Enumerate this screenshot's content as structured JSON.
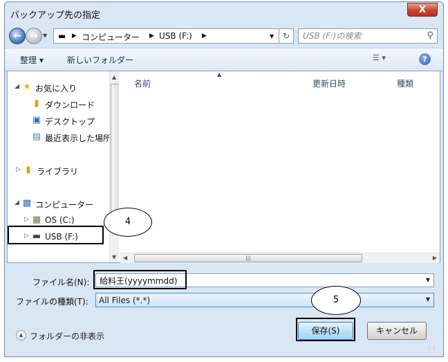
{
  "window": {
    "title": "バックアップ先の指定",
    "close_label": "X"
  },
  "address": {
    "crumbs": [
      "コンピューター",
      "USB (F:)"
    ],
    "search_placeholder": "USB (F:)の検索"
  },
  "toolbar": {
    "organize_label": "整理 ▾",
    "new_folder_label": "新しいフォルダー"
  },
  "nav": {
    "favorites": "お気に入り",
    "downloads": "ダウンロード",
    "desktop": "デスクトップ",
    "recent": "最近表示した場所",
    "libraries": "ライブラリ",
    "computer": "コンピューター",
    "os_drive": "OS (C:)",
    "usb_drive": "USB (F:)"
  },
  "columns": [
    "名前",
    "更新日時",
    "種類"
  ],
  "filename": {
    "label": "ファイル名(N):",
    "value": "給料王(yyyymmdd)"
  },
  "filetype": {
    "label": "ファイルの種類(T):",
    "value": "All Files (*.*)"
  },
  "buttons": {
    "save": "保存(S)",
    "cancel": "キャンセル"
  },
  "hide_folders_label": "フォルダーの非表示",
  "callouts": {
    "step4": "4",
    "step5": "5"
  },
  "colors": {
    "accent": "#3c7fb1",
    "window_bg": "#d9e6f4",
    "star": "#f2b705"
  },
  "icons": {
    "back": "back-arrow-icon",
    "forward": "forward-arrow-icon",
    "search": "search-icon",
    "refresh": "refresh-icon",
    "help": "help-icon",
    "view": "view-options-icon",
    "star": "star-icon",
    "folder": "folder-icon",
    "computer": "computer-icon",
    "drive": "drive-icon"
  }
}
